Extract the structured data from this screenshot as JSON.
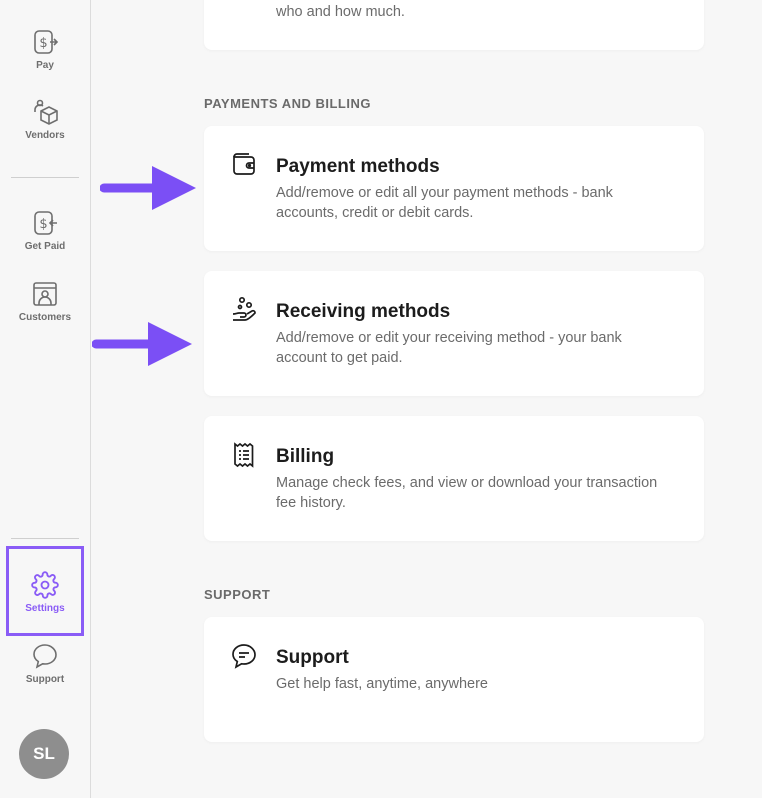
{
  "sidebar": {
    "items": [
      {
        "label": "Pay",
        "icon": "pay-icon"
      },
      {
        "label": "Vendors",
        "icon": "vendors-icon"
      },
      {
        "label": "Get Paid",
        "icon": "get-paid-icon"
      },
      {
        "label": "Customers",
        "icon": "customers-icon"
      },
      {
        "label": "Settings",
        "icon": "gear-icon",
        "active": true
      },
      {
        "label": "Support",
        "icon": "chat-bubble-icon"
      }
    ],
    "avatar_initials": "SL",
    "active_color": "#8a5cf6"
  },
  "main": {
    "top_card_desc": "who and how much.",
    "sections": [
      {
        "title": "PAYMENTS AND BILLING",
        "cards": [
          {
            "title": "Payment methods",
            "desc": "Add/remove or edit all your payment methods - bank accounts, credit or debit cards.",
            "icon": "wallet-icon"
          },
          {
            "title": "Receiving methods",
            "desc": "Add/remove or edit your receiving method - your bank account to get paid.",
            "icon": "hand-coins-icon"
          },
          {
            "title": "Billing",
            "desc": "Manage check fees, and view or download your transaction fee history.",
            "icon": "receipt-icon"
          }
        ]
      },
      {
        "title": "SUPPORT",
        "cards": [
          {
            "title": "Support",
            "desc": "Get help fast, anytime, anywhere",
            "icon": "chat-bubble-icon"
          }
        ]
      }
    ]
  },
  "annotation_color": "#7b4ff5"
}
